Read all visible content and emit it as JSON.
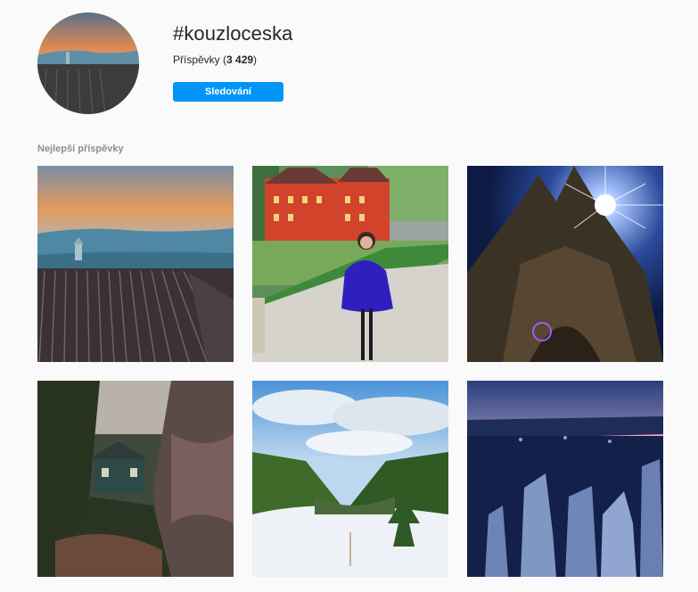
{
  "hashtag": {
    "title": "#kouzloceska",
    "posts_label": "Příspěvky (",
    "posts_count": "3 429",
    "posts_suffix": ")",
    "follow_label": "Sledování"
  },
  "section": {
    "top_posts_label": "Nejlepší příspěvky"
  },
  "posts": [
    {
      "image": "vineyard-sunset-chapel"
    },
    {
      "image": "red-castle-woman-blue-dress"
    },
    {
      "image": "cathedral-sunburst-night"
    },
    {
      "image": "cabin-in-forest-gorge"
    },
    {
      "image": "snowy-valley-spruce"
    },
    {
      "image": "rock-towers-dusk"
    }
  ],
  "colors": {
    "accent": "#0095f6",
    "muted": "#8e8e8e",
    "background": "#fafafa"
  }
}
